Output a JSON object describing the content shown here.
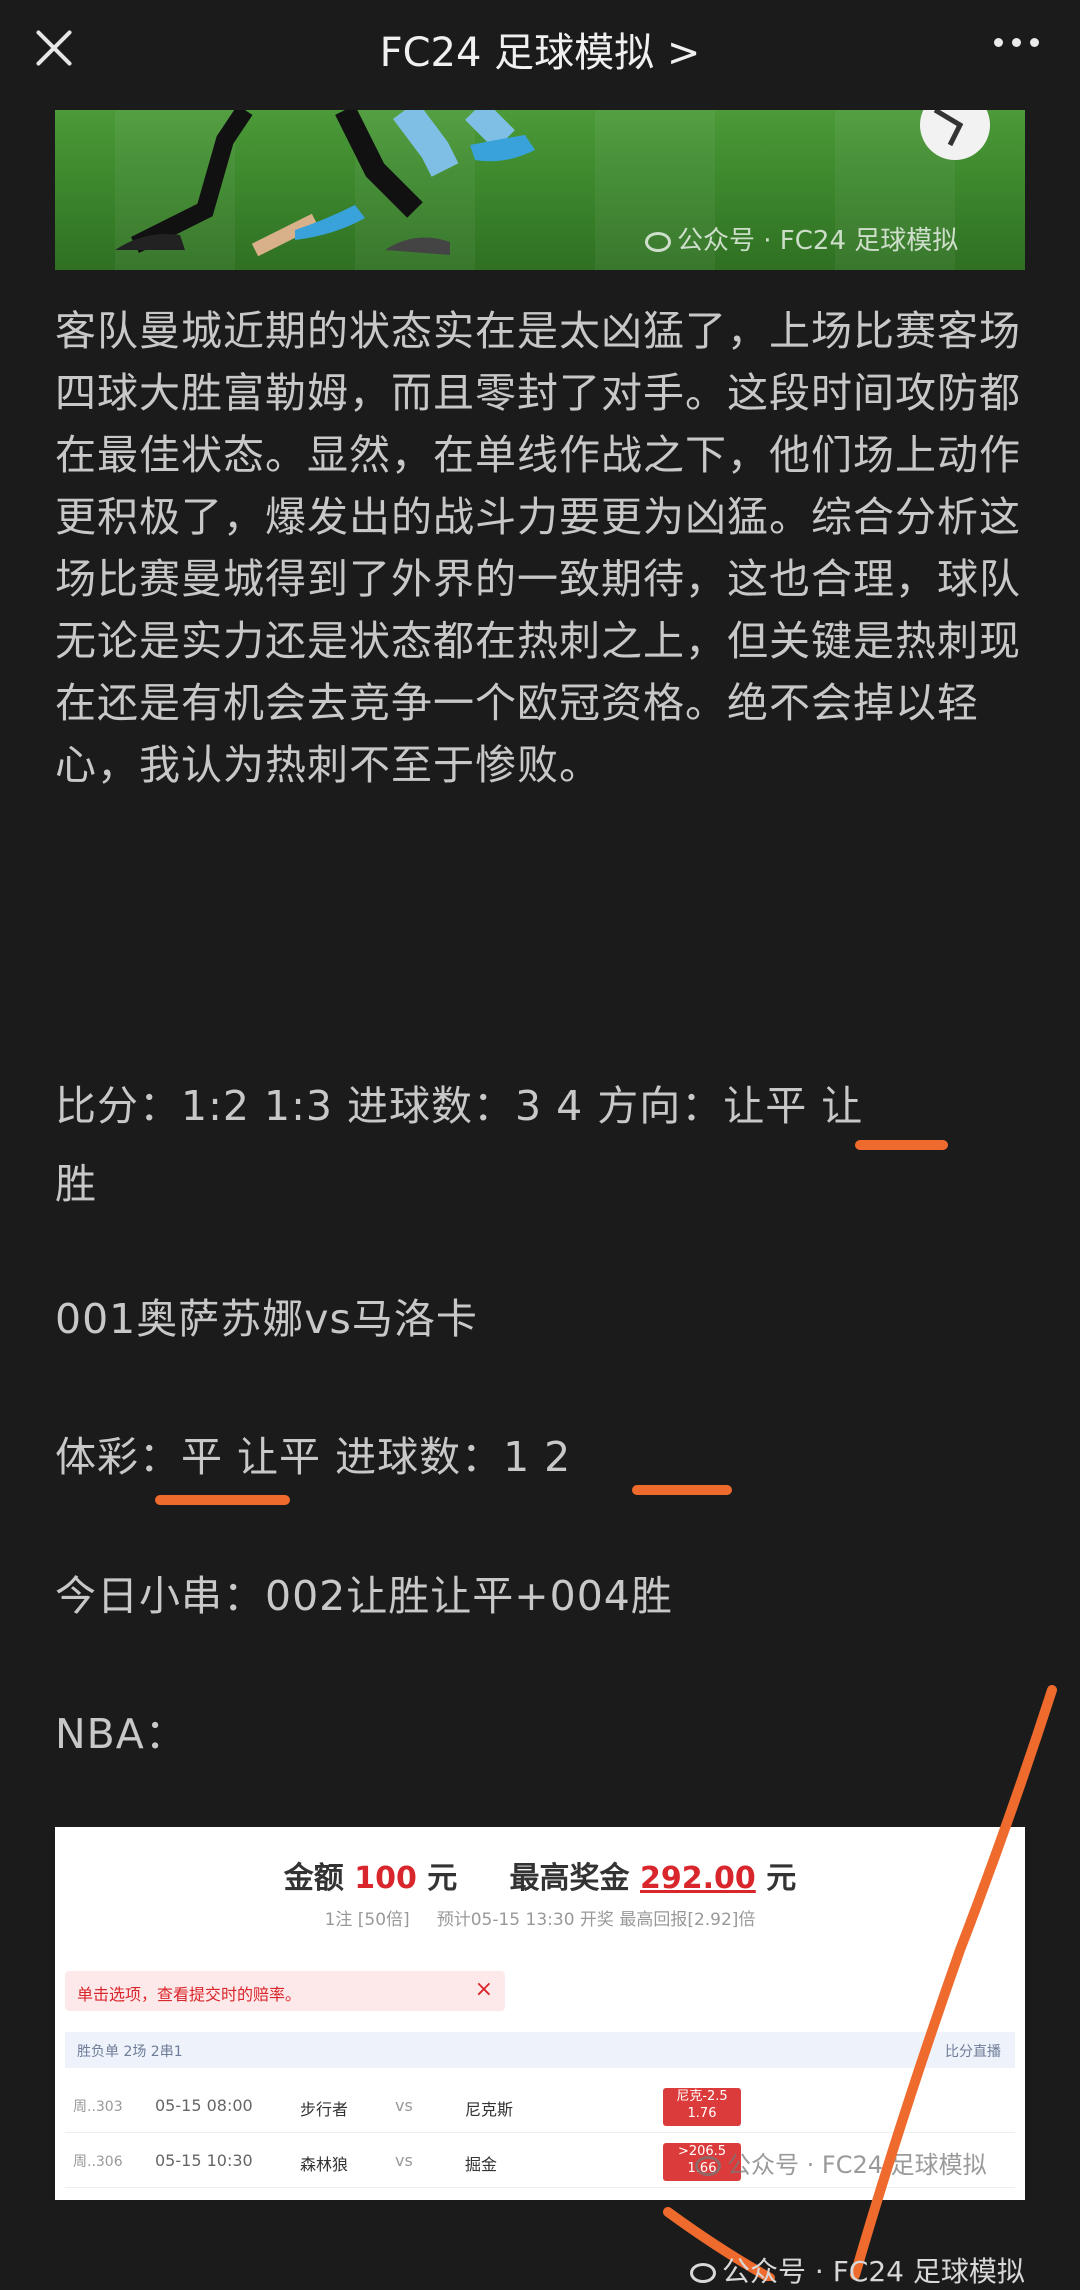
{
  "header": {
    "title": "FC24 足球模拟 >"
  },
  "hero": {
    "watermark": "公众号 · FC24 足球模拟"
  },
  "article": {
    "paragraph": "客队曼城近期的状态实在是太凶猛了，上场比赛客场四球大胜富勒姆，而且零封了对手。这段时间攻防都在最佳状态。显然，在单线作战之下，他们场上动作更积极了，爆发出的战斗力要更为凶猛。综合分析这场比赛曼城得到了外界的一致期待，这也合理，球队无论是实力还是状态都在热刺之上，但关键是热刺现在还是有机会去竞争一个欧冠资格。绝不会掉以轻心，我认为热刺不至于惨败。",
    "prediction_line1": "比分：1:2   1:3     进球数：3 4    方向：让平 让",
    "prediction_line2": "胜",
    "match": "001奥萨苏娜vs马洛卡",
    "lottery": "体彩：平 让平    进球数：1 2",
    "combo": "今日小串：002让胜让平+004胜",
    "nba": "NBA："
  },
  "ticket": {
    "amount_label": "金额",
    "amount_value": "100",
    "amount_unit": "元",
    "max_label": "最高奖金",
    "max_value": "292.00",
    "max_unit": "元",
    "sub1": "1注 [50倍]",
    "sub2": "预计05-15 13:30 开奖   最高回报[2.92]倍",
    "hint": "单击选项，查看提交时的赔率。",
    "hint_close": "×",
    "bar_left": "胜负单  2场  2串1",
    "bar_right": "比分直播",
    "rows": [
      {
        "code": "周..303",
        "time": "05-15 08:00",
        "home": "步行者",
        "vs": "vs",
        "away": "尼克斯",
        "odd_top": "尼克-2.5",
        "odd_bottom": "1.76"
      },
      {
        "code": "周..306",
        "time": "05-15 10:30",
        "home": "森林狼",
        "vs": "vs",
        "away": "掘金",
        "odd_top": ">206.5",
        "odd_bottom": "1.66"
      }
    ],
    "watermark": "公众号 · FC24 足球模拟"
  },
  "footer": {
    "watermark": "公众号 · FC24 足球模拟"
  },
  "colors": {
    "background": "#1b1b1b",
    "text": "#c8c8c8",
    "underline": "#ef6a2d",
    "ticket_red": "#d9262c"
  }
}
